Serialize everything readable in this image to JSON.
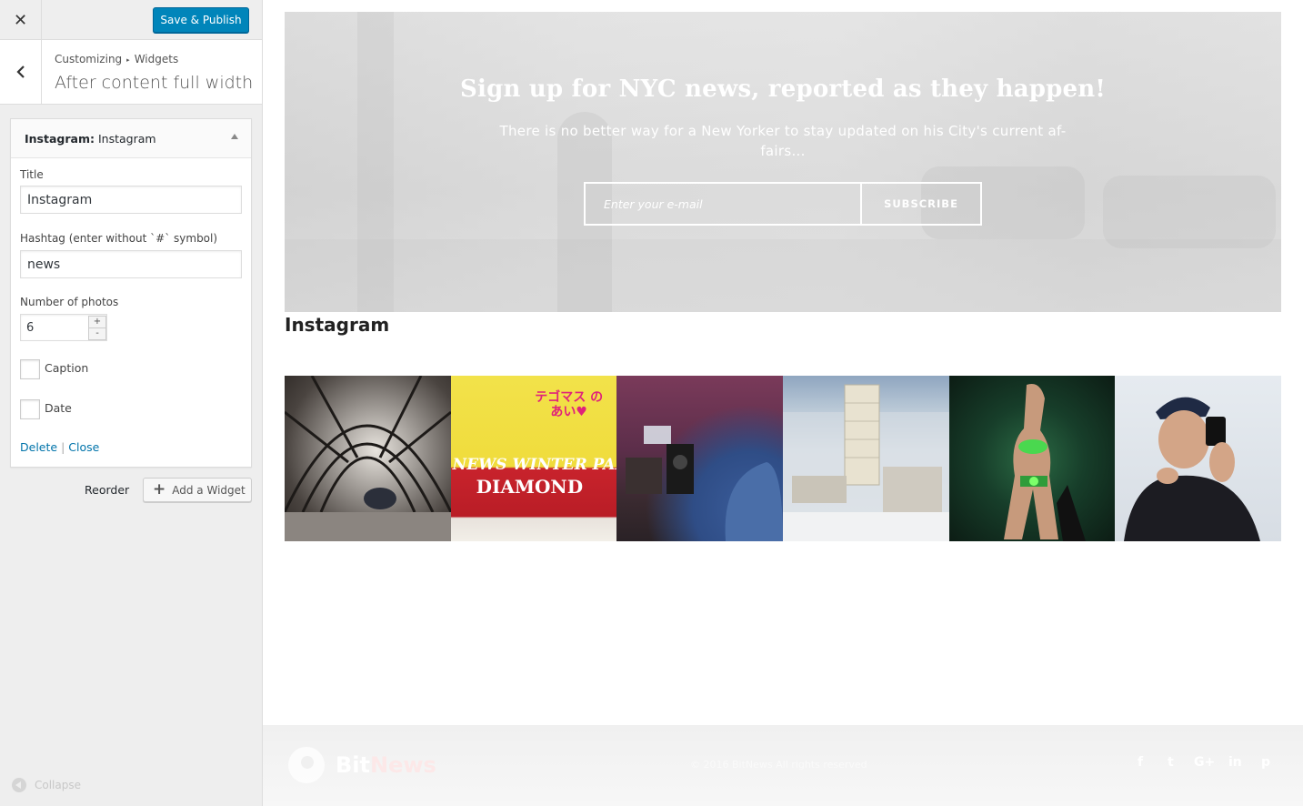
{
  "customizer": {
    "close_icon": "close-icon",
    "save_label": "Save & Publish",
    "back_icon": "chevron-left-icon",
    "breadcrumb": {
      "root": "Customizing",
      "separator": "▸",
      "current": "Widgets"
    },
    "section_title": "After content full width ...",
    "widget": {
      "title_prefix": "Instagram:",
      "title_name": "Instagram",
      "fields": {
        "title_label": "Title",
        "title_value": "Instagram",
        "hashtag_label": "Hashtag (enter without `#` symbol)",
        "hashtag_value": "news",
        "photos_label": "Number of photos",
        "photos_value": "6",
        "stepper_up": "+",
        "stepper_down": "-",
        "caption_label": "Caption",
        "date_label": "Date"
      },
      "delete_label": "Delete",
      "link_separator": "|",
      "close_label": "Close"
    },
    "reorder_label": "Reorder",
    "add_widget_label": "Add a Widget",
    "collapse_label": "Collapse"
  },
  "preview": {
    "hero": {
      "title": "Sign up for NYC news, reported as they happen!",
      "text": "There is no better way for a New Yorker to stay updated on his City's current af- fairs...",
      "email_placeholder": "Enter your e-mail",
      "subscribe_label": "SUBSCRIBE"
    },
    "instagram_heading": "Instagram",
    "photos": [
      {
        "label": "tunnel-photo"
      },
      {
        "label": "sign-photo",
        "line1": "テゴマス の あい♥",
        "line2": "NEWS WINTER PARTY",
        "line3": "DIAMOND"
      },
      {
        "label": "studio-photo"
      },
      {
        "label": "city-photo"
      },
      {
        "label": "costume-photo"
      },
      {
        "label": "selfie-photo"
      }
    ],
    "footer": {
      "logo_bit": "Bit",
      "logo_news": "News",
      "copyright": "© 2016 BitNews All rights reserved",
      "social": [
        "f",
        "t",
        "G+",
        "in",
        "p"
      ]
    }
  }
}
